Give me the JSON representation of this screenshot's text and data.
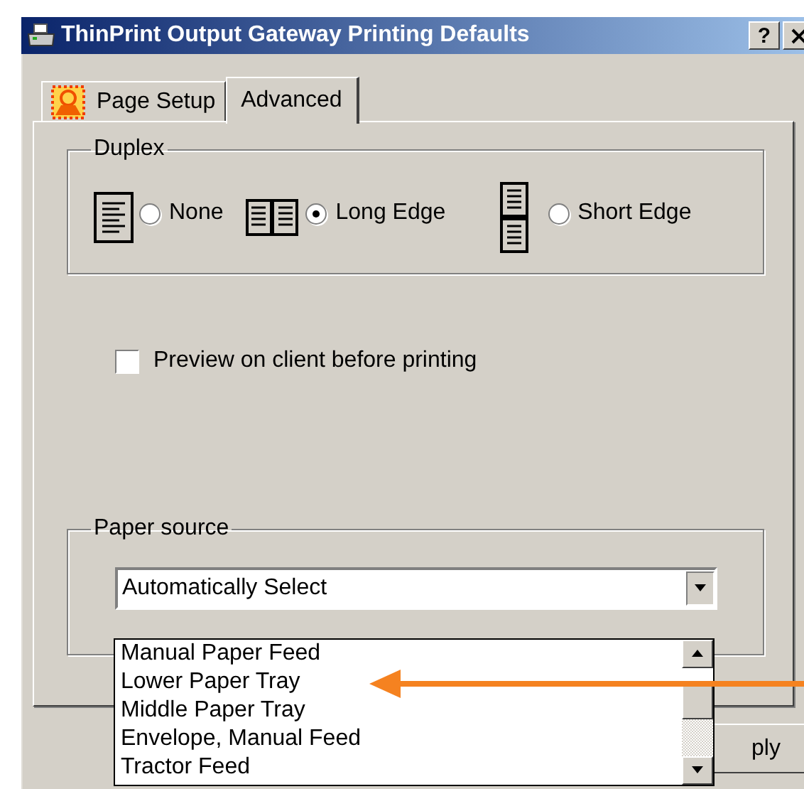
{
  "window": {
    "title": "ThinPrint Output Gateway Printing Defaults",
    "help_button": "?"
  },
  "tabs": [
    {
      "label": "Page Setup",
      "selected": false,
      "kind": "icon"
    },
    {
      "label": "Advanced",
      "selected": true,
      "kind": "plain"
    }
  ],
  "duplex": {
    "title": "Duplex",
    "options": [
      {
        "label": "None",
        "kind": "single",
        "selected": false
      },
      {
        "label": "Long Edge",
        "kind": "book",
        "selected": true
      },
      {
        "label": "Short Edge",
        "kind": "tablet",
        "selected": false
      }
    ]
  },
  "preview": {
    "label": "Preview on client before printing",
    "checked": false
  },
  "paper_source": {
    "title": "Paper source",
    "value": "Automatically Select",
    "expanded": true,
    "options": [
      "Manual Paper Feed",
      "Lower Paper Tray",
      "Middle Paper Tray",
      "Envelope, Manual Feed",
      "Tractor Feed"
    ]
  },
  "apply_button": "ply"
}
